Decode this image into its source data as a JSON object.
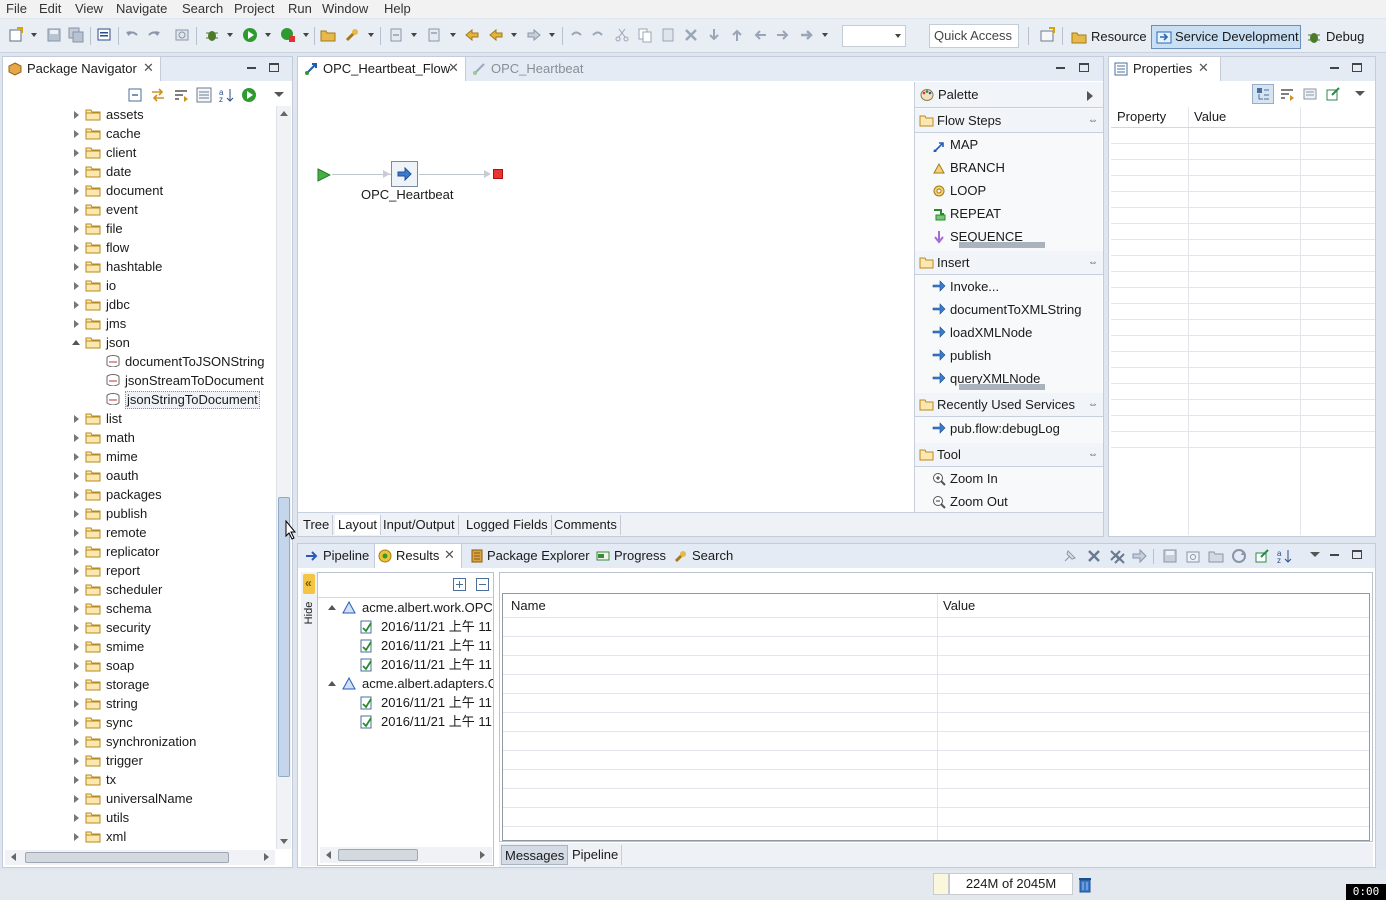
{
  "menu": [
    "File",
    "Edit",
    "View",
    "Navigate",
    "Search",
    "Project",
    "Run",
    "Window",
    "Help"
  ],
  "toolbar": {
    "quick_access": "Quick Access",
    "perspectives": [
      "Resource",
      "Service Development",
      "Debug"
    ]
  },
  "navigator": {
    "tab_label": "Package Navigator",
    "items": [
      {
        "label": "assets",
        "type": "folder",
        "expanded": false
      },
      {
        "label": "cache",
        "type": "folder",
        "expanded": false
      },
      {
        "label": "client",
        "type": "folder",
        "expanded": false
      },
      {
        "label": "date",
        "type": "folder",
        "expanded": false
      },
      {
        "label": "document",
        "type": "folder",
        "expanded": false
      },
      {
        "label": "event",
        "type": "folder",
        "expanded": false
      },
      {
        "label": "file",
        "type": "folder",
        "expanded": false
      },
      {
        "label": "flow",
        "type": "folder",
        "expanded": false
      },
      {
        "label": "hashtable",
        "type": "folder",
        "expanded": false
      },
      {
        "label": "io",
        "type": "folder",
        "expanded": false
      },
      {
        "label": "jdbc",
        "type": "folder",
        "expanded": false
      },
      {
        "label": "jms",
        "type": "folder",
        "expanded": false
      },
      {
        "label": "json",
        "type": "folder",
        "expanded": true
      },
      {
        "label": "documentToJSONString",
        "type": "service",
        "expanded": false
      },
      {
        "label": "jsonStreamToDocument",
        "type": "service",
        "expanded": false
      },
      {
        "label": "jsonStringToDocument",
        "type": "service",
        "expanded": false,
        "selected": true
      },
      {
        "label": "list",
        "type": "folder",
        "expanded": false
      },
      {
        "label": "math",
        "type": "folder",
        "expanded": false
      },
      {
        "label": "mime",
        "type": "folder",
        "expanded": false
      },
      {
        "label": "oauth",
        "type": "folder",
        "expanded": false
      },
      {
        "label": "packages",
        "type": "folder",
        "expanded": false
      },
      {
        "label": "publish",
        "type": "folder",
        "expanded": false
      },
      {
        "label": "remote",
        "type": "folder",
        "expanded": false
      },
      {
        "label": "replicator",
        "type": "folder",
        "expanded": false
      },
      {
        "label": "report",
        "type": "folder",
        "expanded": false
      },
      {
        "label": "scheduler",
        "type": "folder",
        "expanded": false
      },
      {
        "label": "schema",
        "type": "folder",
        "expanded": false
      },
      {
        "label": "security",
        "type": "folder",
        "expanded": false
      },
      {
        "label": "smime",
        "type": "folder",
        "expanded": false
      },
      {
        "label": "soap",
        "type": "folder",
        "expanded": false
      },
      {
        "label": "storage",
        "type": "folder",
        "expanded": false
      },
      {
        "label": "string",
        "type": "folder",
        "expanded": false
      },
      {
        "label": "sync",
        "type": "folder",
        "expanded": false
      },
      {
        "label": "synchronization",
        "type": "folder",
        "expanded": false
      },
      {
        "label": "trigger",
        "type": "folder",
        "expanded": false
      },
      {
        "label": "tx",
        "type": "folder",
        "expanded": false
      },
      {
        "label": "universalName",
        "type": "folder",
        "expanded": false
      },
      {
        "label": "utils",
        "type": "folder",
        "expanded": false
      },
      {
        "label": "xml",
        "type": "folder",
        "expanded": false
      }
    ]
  },
  "editor": {
    "tabs": [
      {
        "label": "OPC_Heartbeat_Flow",
        "active": true
      },
      {
        "label": "OPC_Heartbeat",
        "active": false
      }
    ],
    "flow_node_label": "OPC_Heartbeat",
    "bottom_tabs": [
      "Tree",
      "Layout",
      "Input/Output",
      "Logged Fields",
      "Comments"
    ],
    "active_bottom_tab": "Layout"
  },
  "palette": {
    "title": "Palette",
    "groups": [
      {
        "name": "Flow Steps",
        "items": [
          "MAP",
          "BRANCH",
          "LOOP",
          "REPEAT",
          "SEQUENCE"
        ]
      },
      {
        "name": "Insert",
        "items": [
          "Invoke...",
          "documentToXMLString",
          "loadXMLNode",
          "publish",
          "queryXMLNode"
        ]
      },
      {
        "name": "Recently Used Services",
        "items": [
          "pub.flow:debugLog"
        ]
      },
      {
        "name": "Tool",
        "items": [
          "Zoom In",
          "Zoom Out"
        ]
      }
    ]
  },
  "properties": {
    "tab_label": "Properties",
    "columns": [
      "Property",
      "Value"
    ]
  },
  "results": {
    "tabs": [
      "Pipeline",
      "Results",
      "Package Explorer",
      "Progress",
      "Search"
    ],
    "active_tab": "Results",
    "hide_label": "Hide",
    "tree": [
      {
        "label": "acme.albert.work.OPC:",
        "children": [
          "2016/11/21 上午 11",
          "2016/11/21 上午 11",
          "2016/11/21 上午 11"
        ]
      },
      {
        "label": "acme.albert.adapters.C",
        "children": [
          "2016/11/21 上午 11",
          "2016/11/21 上午 11"
        ]
      }
    ],
    "table_columns": [
      "Name",
      "Value"
    ],
    "bottom_tabs": [
      "Messages",
      "Pipeline"
    ],
    "active_bottom_tab": "Messages"
  },
  "status": {
    "memory": "224M of 2045M",
    "clock": "0:00"
  }
}
